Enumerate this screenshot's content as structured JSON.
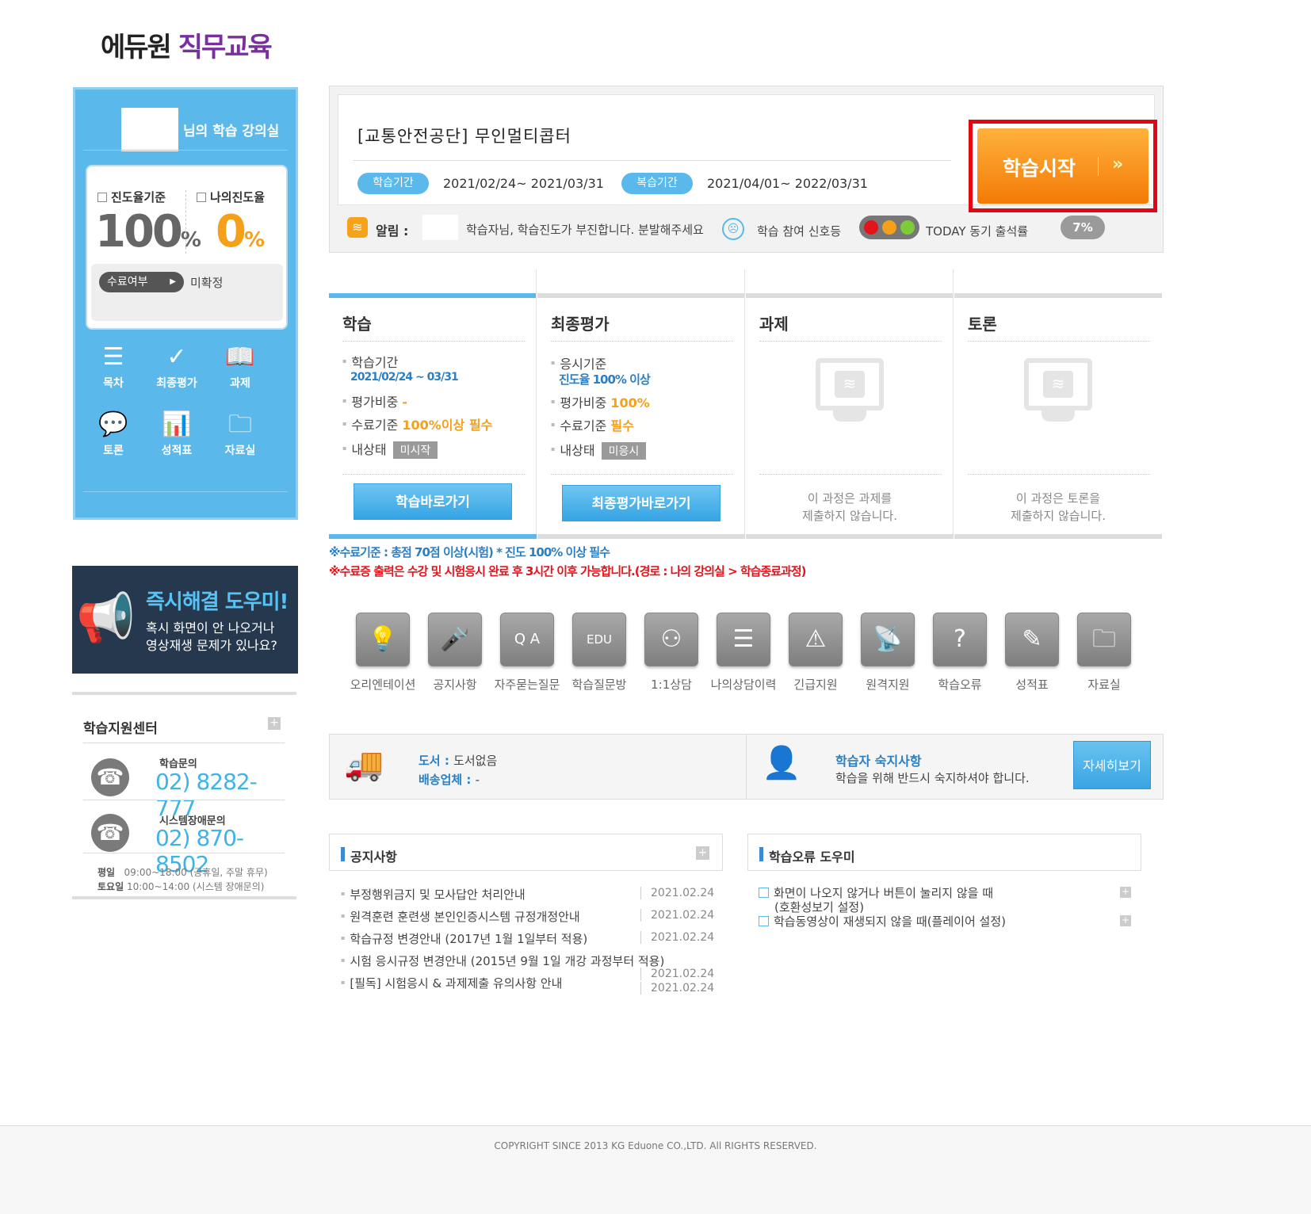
{
  "logo": {
    "part1": "에듀원",
    "part2": "직무교육"
  },
  "profile": {
    "room_title": "님의 학습 강의실",
    "progress_std_label": "진도율기준",
    "progress_std_value": "100",
    "my_progress_label": "나의진도율",
    "my_progress_value": "0",
    "pct": "%",
    "complete_label": "수료여부",
    "complete_value": "미확정",
    "menu": [
      {
        "label": "목차",
        "icon": "list-icon"
      },
      {
        "label": "최종평가",
        "icon": "check-icon"
      },
      {
        "label": "과제",
        "icon": "book-icon"
      },
      {
        "label": "토론",
        "icon": "chat-icon"
      },
      {
        "label": "성적표",
        "icon": "chart-icon"
      },
      {
        "label": "자료실",
        "icon": "folder-icon"
      }
    ]
  },
  "help_banner": {
    "title": "즉시해결 도우미!",
    "line1": "혹시 화면이 안 나오거나",
    "line2": "영상재생 문제가 있나요?"
  },
  "support": {
    "title": "학습지원센터",
    "study_label": "학습문의",
    "study_phone": "02) 8282-777",
    "system_label": "시스템장애문의",
    "system_phone": "02) 870-8502",
    "weekday_label": "평일",
    "weekday_hours": "09:00~18:00 (공휴일, 주말 휴무)",
    "sat_label": "토요일",
    "sat_hours": "10:00~14:00 (시스템 장애문의)"
  },
  "course": {
    "title": "[교통안전공단] 무인멀티콥터",
    "study_period_label": "학습기간",
    "study_period": "2021/02/24~ 2021/03/31",
    "review_period_label": "복습기간",
    "review_period": "2021/04/01~ 2022/03/31",
    "start_button": "학습시작",
    "start_chevron": "»",
    "alarm_label": "알림 :",
    "alarm_msg": "학습자님, 학습진도가 부진합니다. 분발해주세요",
    "signal_label": "학습 참여 신호등",
    "today_label": "TODAY 동기 출석률",
    "today_rate": "7%"
  },
  "columns": {
    "study": {
      "title": "학습",
      "period_label": "학습기간",
      "period_value": "2021/02/24 ~ 03/31",
      "weight_label": "평가비중",
      "weight_value": "-",
      "criteria_label": "수료기준",
      "criteria_value": "100%이상 필수",
      "status_label": "내상태",
      "status_value": "미시작",
      "button": "학습바로가기"
    },
    "final": {
      "title": "최종평가",
      "req_label": "응시기준",
      "req_value": "진도율 100% 이상",
      "weight_label": "평가비중",
      "weight_value": "100%",
      "criteria_label": "수료기준",
      "criteria_value": "필수",
      "status_label": "내상태",
      "status_value": "미응시",
      "button": "최종평가바로가기"
    },
    "task": {
      "title": "과제",
      "empty1": "이 과정은 과제를",
      "empty2": "제출하지 않습니다."
    },
    "discuss": {
      "title": "토론",
      "empty1": "이 과정은 토론을",
      "empty2": "제출하지 않습니다."
    }
  },
  "notes": {
    "line1": "※수료기준 : 총점 70점 이상(시험) * 진도 100% 이상 필수",
    "line2": "※수료증 출력은 수강 및 시험응시 완료 후 3시간 이후 가능합니다.(경로 : 나의 강의실 > 학습종료과정)"
  },
  "icon_menu": [
    {
      "label": "오리엔테이션",
      "icon": "bulb-icon",
      "glyph": "💡"
    },
    {
      "label": "공지사항",
      "icon": "mic-icon",
      "glyph": "🎤"
    },
    {
      "label": "자주묻는질문",
      "icon": "qa-icon",
      "glyph": "Q A"
    },
    {
      "label": "학습질문방",
      "icon": "edu-icon",
      "glyph": "EDU"
    },
    {
      "label": "1:1상담",
      "icon": "counsel-icon",
      "glyph": "⚇"
    },
    {
      "label": "나의상담이력",
      "icon": "notebook-icon",
      "glyph": "☰"
    },
    {
      "label": "긴급지원",
      "icon": "alarm-icon",
      "glyph": "⚠"
    },
    {
      "label": "원격지원",
      "icon": "satellite-icon",
      "glyph": "📡"
    },
    {
      "label": "학습오류",
      "icon": "question-icon",
      "glyph": "?"
    },
    {
      "label": "성적표",
      "icon": "report-icon",
      "glyph": "✎"
    },
    {
      "label": "자료실",
      "icon": "folder-icon",
      "glyph": "🗀"
    }
  ],
  "info": {
    "book_label": "도서 :",
    "book_value": "도서없음",
    "ship_label": "배송업체 :",
    "ship_value": "-",
    "notice_title": "학습자 숙지사항",
    "notice_text": "학습을 위해 반드시 숙지하셔야 합니다.",
    "detail_button": "자세히보기"
  },
  "notices": {
    "title": "공지사항",
    "items": [
      {
        "title": "부정행위금지 및 모사답안 처리안내",
        "date": "2021.02.24"
      },
      {
        "title": "원격훈련 훈련생 본인인증시스템 규정개정안내",
        "date": "2021.02.24"
      },
      {
        "title": "학습규정 변경안내 (2017년 1월 1일부터 적용)",
        "date": "2021.02.24"
      },
      {
        "title": "시험 응시규정 변경안내 (2015년 9월 1일 개강 과정부터 적용)",
        "date": "2021.02.24"
      },
      {
        "title": "[필독] 시험응시 & 과제제출 유의사항 안내",
        "date": "2021.02.24"
      }
    ]
  },
  "help_panel": {
    "title": "학습오류 도우미",
    "item1_line1": "화면이 나오지 않거나 버튼이 눌리지 않을 때",
    "item1_line2": "(호환성보기 설정)",
    "item2": "학습동영상이 재생되지 않을 때(플레이어 설정)"
  },
  "footer": {
    "copyright": "COPYRIGHT SINCE 2013 KG Eduone CO.,LTD. All RIGHTS RESERVED."
  }
}
